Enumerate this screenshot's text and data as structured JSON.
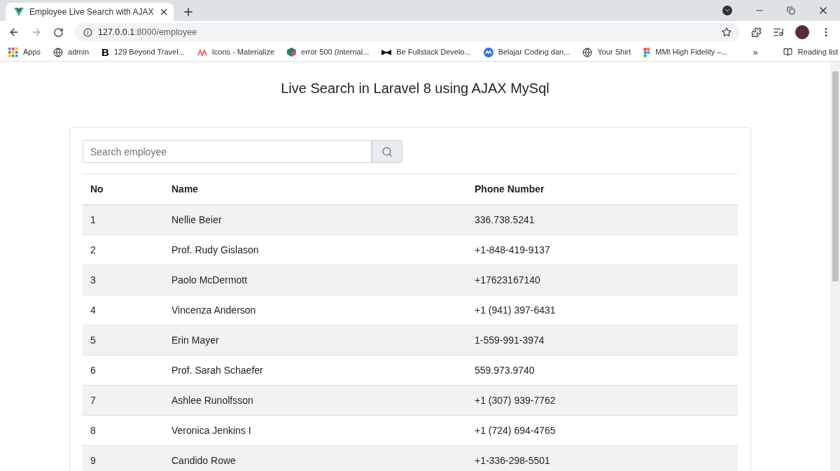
{
  "browser": {
    "tabs": [
      {
        "title": "Employee Live Search with AJAX",
        "selected": true
      }
    ],
    "url_host": "127.0.0.1",
    "url_path": ":8000/employee",
    "bookmarks": [
      {
        "label": "Apps",
        "kind": "apps"
      },
      {
        "label": "admin",
        "kind": "globe"
      },
      {
        "label": "129 Beyond Travel...",
        "kind": "letter",
        "glyph": "B"
      },
      {
        "label": "Icons - Materialize",
        "kind": "materialize"
      },
      {
        "label": "error 500 (Internal...",
        "kind": "cube"
      },
      {
        "label": "Be Fullstack Develo...",
        "kind": "bowtie"
      },
      {
        "label": "Belajar Coding dan...",
        "kind": "wave"
      },
      {
        "label": "Your Shirt",
        "kind": "globe"
      },
      {
        "label": "MMI High Fidelity –...",
        "kind": "figma"
      }
    ],
    "more": "»",
    "reading_list": "Reading list"
  },
  "page": {
    "heading": "Live Search in Laravel 8 using AJAX MySql",
    "search": {
      "placeholder": "Search employee"
    },
    "table": {
      "columns": [
        "No",
        "Name",
        "Phone Number"
      ],
      "rows": [
        [
          "1",
          "Nellie Beier",
          "336.738.5241"
        ],
        [
          "2",
          "Prof. Rudy Gislason",
          "+1-848-419-9137"
        ],
        [
          "3",
          "Paolo McDermott",
          "+17623167140"
        ],
        [
          "4",
          "Vincenza Anderson",
          "+1 (941) 397-6431"
        ],
        [
          "5",
          "Erin Mayer",
          "1-559-991-3974"
        ],
        [
          "6",
          "Prof. Sarah Schaefer",
          "559.973.9740"
        ],
        [
          "7",
          "Ashlee Runolfsson",
          "+1 (307) 939-7762"
        ],
        [
          "8",
          "Veronica Jenkins I",
          "+1 (724) 694-4765"
        ],
        [
          "9",
          "Candido Rowe",
          "+1-336-298-5501"
        ]
      ]
    }
  }
}
